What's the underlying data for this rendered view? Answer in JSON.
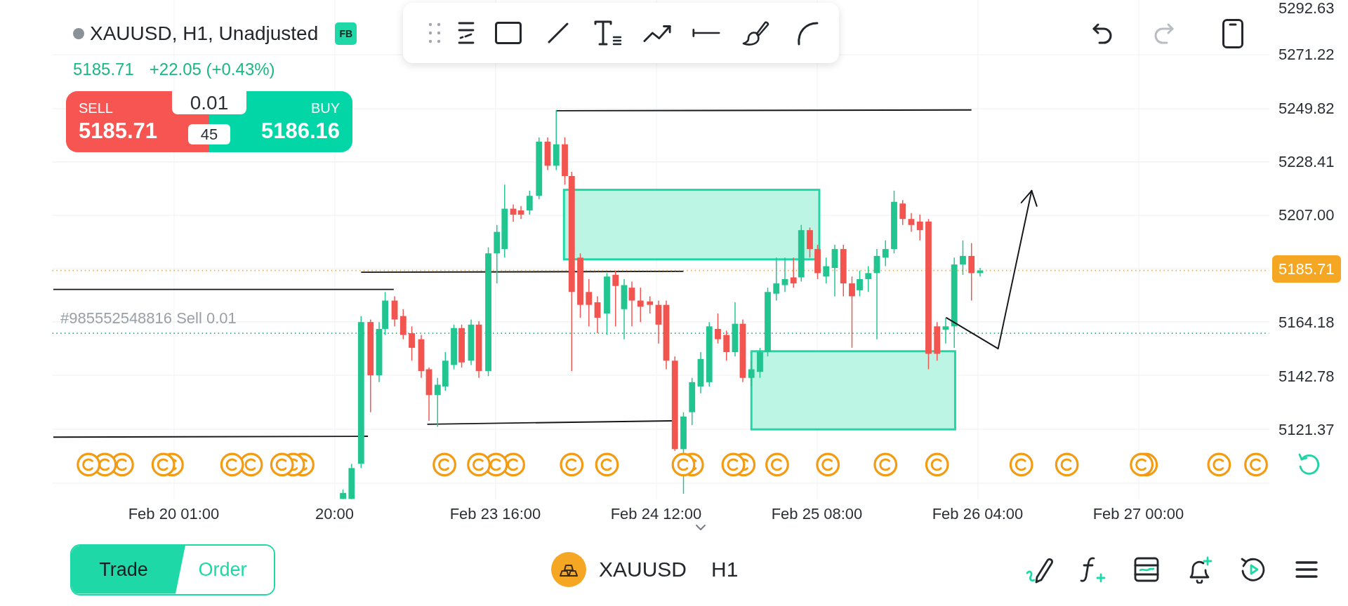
{
  "symbol_header": {
    "title": "XAUUSD, H1, Unadjusted",
    "badge": "FB",
    "last_price": "5185.71",
    "change": "+22.05 (+0.43%)"
  },
  "trade_panel": {
    "sell": {
      "label": "SELL",
      "price": "5185.71"
    },
    "lot_size": "0.01",
    "spread": "45",
    "buy": {
      "label": "BUY",
      "price": "5186.16"
    }
  },
  "history_actions": [
    {
      "kind": "undo",
      "disabled": false
    },
    {
      "kind": "redo",
      "disabled": true
    }
  ],
  "chart": {
    "order_label": "#985552548816 Sell 0.01"
  },
  "price_axis": [
    {
      "kind": "tick",
      "text": "5292.63"
    },
    {
      "kind": "tick",
      "text": "5271.22"
    },
    {
      "kind": "tick",
      "text": "5249.82"
    },
    {
      "kind": "tick",
      "text": "5228.41"
    },
    {
      "kind": "tick",
      "text": "5207.00"
    },
    {
      "kind": "current",
      "text": "5185.71"
    },
    {
      "kind": "tick",
      "text": "5164.18"
    },
    {
      "kind": "tick",
      "text": "5142.78"
    },
    {
      "kind": "tick",
      "text": "5121.37"
    }
  ],
  "time_axis": [
    "Feb 20 01:00",
    "20:00",
    "Feb 23 16:00",
    "Feb 24 12:00",
    "Feb 25 08:00",
    "Feb 26 04:00",
    "Feb 27 00:00"
  ],
  "bottom_bar": {
    "mode_tabs": [
      {
        "label": "Trade",
        "selected": true
      },
      {
        "label": "Order",
        "selected": false
      }
    ],
    "symbol": "XAUUSD",
    "timeframe": "H1"
  }
}
